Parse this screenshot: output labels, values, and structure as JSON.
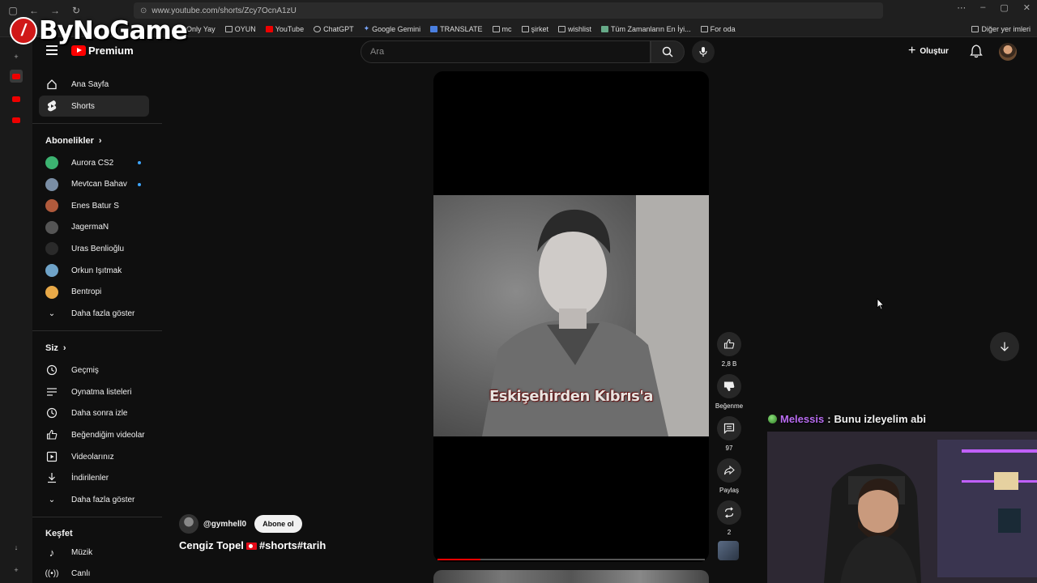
{
  "browser": {
    "url": "www.youtube.com/shorts/Zcy7OcnA1zU",
    "bookmarks": [
      "Only Yay",
      "OYUN",
      "YouTube",
      "ChatGPT",
      "Google Gemini",
      "TRANSLATE",
      "mc",
      "şirket",
      "wishlist",
      "Tüm Zamanların En İyi...",
      "For oda"
    ],
    "other_bookmarks": "Diğer yer imleri"
  },
  "overlay": {
    "logo_text": "ByNoGame"
  },
  "header": {
    "premium_label": "Premium",
    "search_placeholder": "Ara",
    "create_label": "Oluştur"
  },
  "sidebar": {
    "nav": [
      {
        "label": "Ana Sayfa",
        "icon": "home-icon"
      },
      {
        "label": "Shorts",
        "icon": "shorts-icon",
        "active": true
      }
    ],
    "subscriptions_title": "Abonelikler",
    "subscriptions": [
      {
        "label": "Aurora CS2",
        "color": "#3cb371",
        "live": true
      },
      {
        "label": "Mevtcan Bahav",
        "color": "#7a8ea5",
        "live": true
      },
      {
        "label": "Enes Batur S",
        "color": "#b05a3c",
        "live": false
      },
      {
        "label": "JagermaN",
        "color": "#555555",
        "live": false
      },
      {
        "label": "Uras Benlioğlu",
        "color": "#2a2a2a",
        "live": false
      },
      {
        "label": "Orkun Işıtmak",
        "color": "#6fa3c8",
        "live": false
      },
      {
        "label": "Bentropi",
        "color": "#e8a948",
        "live": false
      }
    ],
    "subscriptions_more": "Daha fazla göster",
    "you_title": "Siz",
    "you_items": [
      "Geçmiş",
      "Oynatma listeleri",
      "Daha sonra izle",
      "Beğendiğim videolar",
      "Videolarınız",
      "İndirilenler"
    ],
    "you_more": "Daha fazla göster",
    "explore_title": "Keşfet",
    "explore_items": [
      "Müzik",
      "Canlı"
    ]
  },
  "short": {
    "caption": "Eskişehirden Kıbrıs'a",
    "channel": "@gymhell0",
    "subscribe_label": "Abone ol",
    "title_prefix": "Cengiz Topel",
    "title_suffix": "#shorts#tarih",
    "progress": 0.16,
    "actions": {
      "likes": "2,8 B",
      "dislike_label": "Beğenme",
      "comments": "97",
      "share_label": "Paylaş",
      "remix_count": "2"
    }
  },
  "chat": {
    "user": "Melessis",
    "separator": ":",
    "message": "Bunu izleyelim abi"
  }
}
